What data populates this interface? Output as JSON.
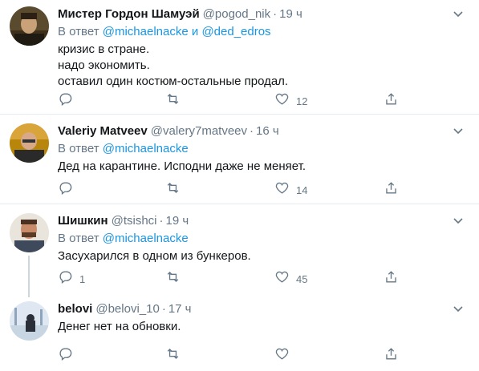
{
  "tweets": [
    {
      "name": "Мистер Гордон Шамуэй",
      "handle": "@pogod_nik",
      "time": "19 ч",
      "reply_prefix": "В ответ",
      "mentions": [
        "@michaelnacke",
        "@ded_edros"
      ],
      "reply_joiner": "и",
      "text": "кризис в стране.\nнадо экономить.\nоставил один костюм-остальные продал.",
      "replies": "",
      "retweets": "",
      "likes": "12"
    },
    {
      "name": "Valeriy Matveev",
      "handle": "@valery7matveev",
      "time": "16 ч",
      "reply_prefix": "В ответ",
      "mentions": [
        "@michaelnacke"
      ],
      "text": "Дед на карантине. Исподни даже не меняет.",
      "replies": "",
      "retweets": "",
      "likes": "14"
    },
    {
      "name": "Шишкин",
      "handle": "@tsishci",
      "time": "19 ч",
      "reply_prefix": "В ответ",
      "mentions": [
        "@michaelnacke"
      ],
      "text": "Засухарился в одном из бункеров.",
      "replies": "1",
      "retweets": "",
      "likes": "45"
    },
    {
      "name": "belovi",
      "handle": "@belovi_10",
      "time": "17 ч",
      "text": "Денег нет на обновки.",
      "replies": "",
      "retweets": "",
      "likes": ""
    }
  ],
  "separator": "·",
  "icons": {
    "reply": "reply-icon",
    "retweet": "retweet-icon",
    "like": "like-icon",
    "share": "share-icon",
    "more": "chevron-down-icon"
  },
  "colors": {
    "text": "#14171a",
    "secondary": "#657786",
    "link": "#1b95e0",
    "border": "#e6ecf0",
    "thread_line": "#ccd6dd"
  }
}
